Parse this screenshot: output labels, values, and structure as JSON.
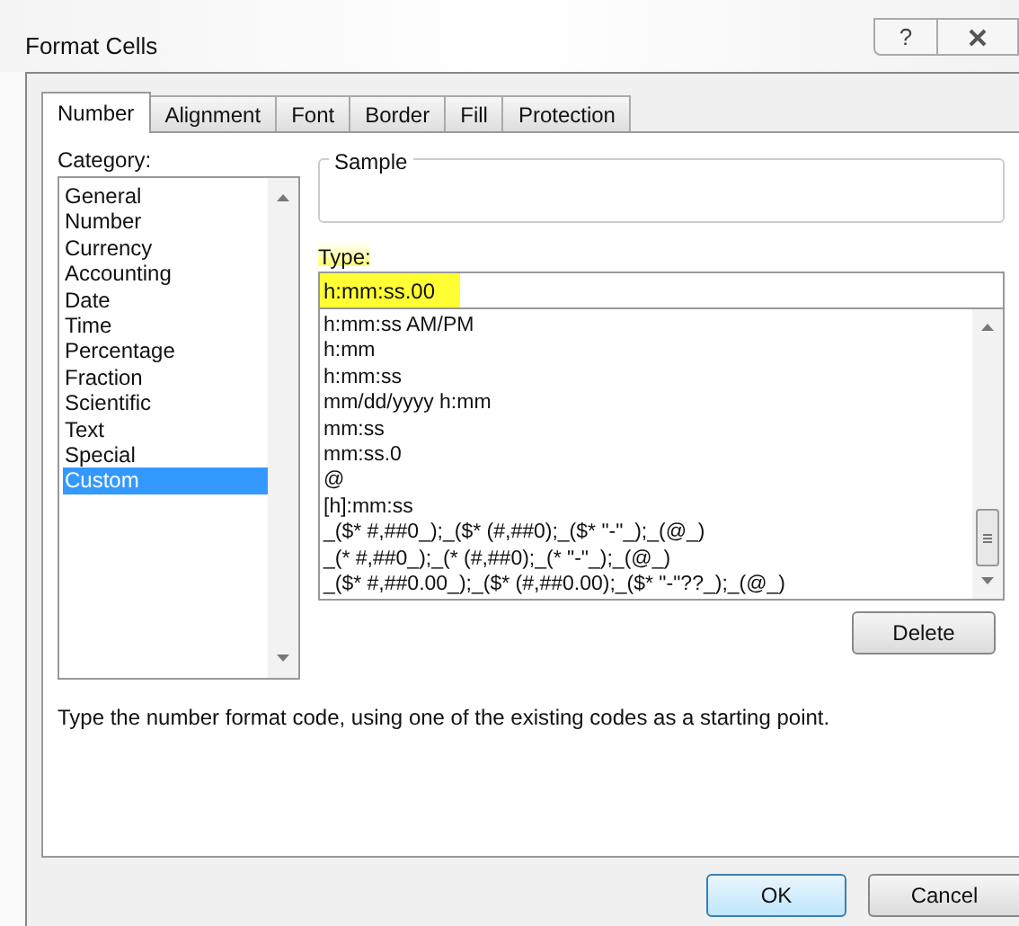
{
  "window": {
    "title": "Format Cells",
    "help_button": "?"
  },
  "tabs": [
    {
      "label": "Number",
      "selected": true
    },
    {
      "label": "Alignment",
      "selected": false
    },
    {
      "label": "Font",
      "selected": false
    },
    {
      "label": "Border",
      "selected": false
    },
    {
      "label": "Fill",
      "selected": false
    },
    {
      "label": "Protection",
      "selected": false
    }
  ],
  "category": {
    "label": "Category:",
    "items": [
      {
        "label": "General",
        "selected": false
      },
      {
        "label": "Number",
        "selected": false
      },
      {
        "label": "Currency",
        "selected": false
      },
      {
        "label": "Accounting",
        "selected": false
      },
      {
        "label": "Date",
        "selected": false
      },
      {
        "label": "Time",
        "selected": false
      },
      {
        "label": "Percentage",
        "selected": false
      },
      {
        "label": "Fraction",
        "selected": false
      },
      {
        "label": "Scientific",
        "selected": false
      },
      {
        "label": "Text",
        "selected": false
      },
      {
        "label": "Special",
        "selected": false
      },
      {
        "label": "Custom",
        "selected": true
      }
    ]
  },
  "sample": {
    "label": "Sample"
  },
  "type": {
    "label": "Type:",
    "value": "h:mm:ss.00",
    "highlighted": true,
    "items": [
      "h:mm:ss AM/PM",
      "h:mm",
      "h:mm:ss",
      "mm/dd/yyyy h:mm",
      "mm:ss",
      "mm:ss.0",
      "@",
      "[h]:mm:ss",
      "_($* #,##0_);_($* (#,##0);_($* \"-\"_);_(@_)",
      "_(* #,##0_);_(* (#,##0);_(* \"-\"_);_(@_)",
      "_($* #,##0.00_);_($* (#,##0.00);_($* \"-\"??_);_(@_)"
    ]
  },
  "delete_button": "Delete",
  "description": "Type the number format code, using one of the existing codes as a starting point.",
  "buttons": [
    {
      "label": "OK",
      "default": true
    },
    {
      "label": "Cancel",
      "default": false
    }
  ]
}
